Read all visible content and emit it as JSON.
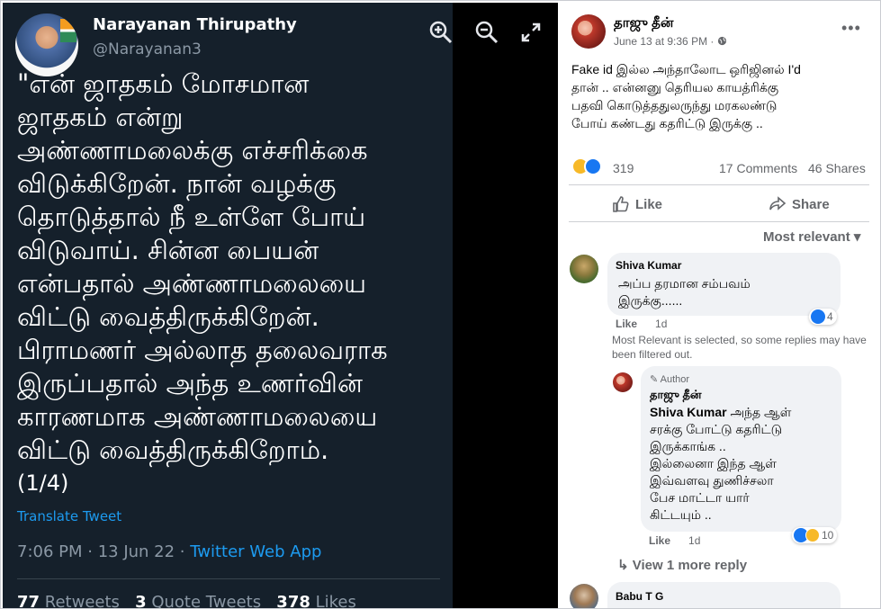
{
  "tweet": {
    "display_name": "Narayanan Thirupathy",
    "handle": "@Narayanan3",
    "text_lines": [
      "\"என் ஜாதகம் மோசமான",
      "ஜாதகம் என்று",
      "அண்ணாமலைக்கு எச்சரிக்கை",
      "விடுக்கிறேன். நான் வழக்கு",
      "தொடுத்தால் நீ உள்ளே போய்",
      "விடுவாய். சின்ன பையன்",
      "என்பதால் அண்ணாமலையை",
      "விட்டு வைத்திருக்கிறேன்.",
      "பிராமணர் அல்லாத தலைவராக",
      "இருப்பதால் அந்த உணர்வின்",
      "காரணமாக அண்ணாமலையை",
      "விட்டு வைத்திருக்கிறோம்."
    ],
    "thread_count": "(1/4)",
    "translate": "Translate Tweet",
    "timestamp": "7:06 PM · 13 Jun 22 · ",
    "source_app": "Twitter Web App",
    "retweets_num": "77",
    "retweets_label": " Retweets",
    "quotes_num": "3",
    "quotes_label": " Quote Tweets",
    "likes_num": "378",
    "likes_label": " Likes"
  },
  "viewer": {
    "icons": [
      "zoom-in-icon",
      "zoom-out-icon",
      "fullscreen-icon"
    ]
  },
  "facebook": {
    "author": "தாஜு தீன்",
    "timestamp": "June 13 at 9:36 PM · ",
    "audience_icon": "globe-icon",
    "more": "•••",
    "text_lines": [
      "Fake id இல்ல அந்தாலோட ஒரிஜினல் I'd",
      "தான் .. என்னனு தெரியல காயத்ரிக்கு",
      "பதவி கொடுத்ததுலருந்து மரகலண்டு",
      "போய் கண்டது கதரிட்டு இருக்கு .."
    ],
    "reaction_count": "319",
    "comments_count": "17 Comments",
    "shares_count": "46 Shares",
    "like_label": "Like",
    "share_label": "Share",
    "sort_label": "Most relevant ▾",
    "filter_note": "Most Relevant is selected, so some replies may have been filtered out.",
    "comments": [
      {
        "author": "Shiva Kumar",
        "text_lines": [
          "அப்ப தரமான சம்பவம்",
          "இருக்கு......"
        ],
        "like_label": "Like",
        "age": "1d",
        "reactions": "4"
      },
      {
        "badge": "Author",
        "author": "தாஜு தீன்",
        "mention": "Shiva Kumar",
        "first_line": " அந்த ஆள்",
        "text_lines": [
          "சரக்கு போட்டு கதரிட்டு",
          "இருக்காங்க ..",
          "இல்லைனா இந்த ஆள்",
          "இவ்வளவு துணிச்சலா",
          "பேச மாட்டா யார்",
          "கிட்டயும் .."
        ],
        "like_label": "Like",
        "age": "1d",
        "reactions": "10"
      }
    ],
    "view_more": "View 1 more reply",
    "next_author": "Babu T G"
  },
  "colors": {
    "twitter_bg": "#15202b",
    "twitter_link": "#1d9bf0",
    "fb_like_blue": "#1877f2",
    "fb_comment_bg": "#f0f2f5"
  }
}
